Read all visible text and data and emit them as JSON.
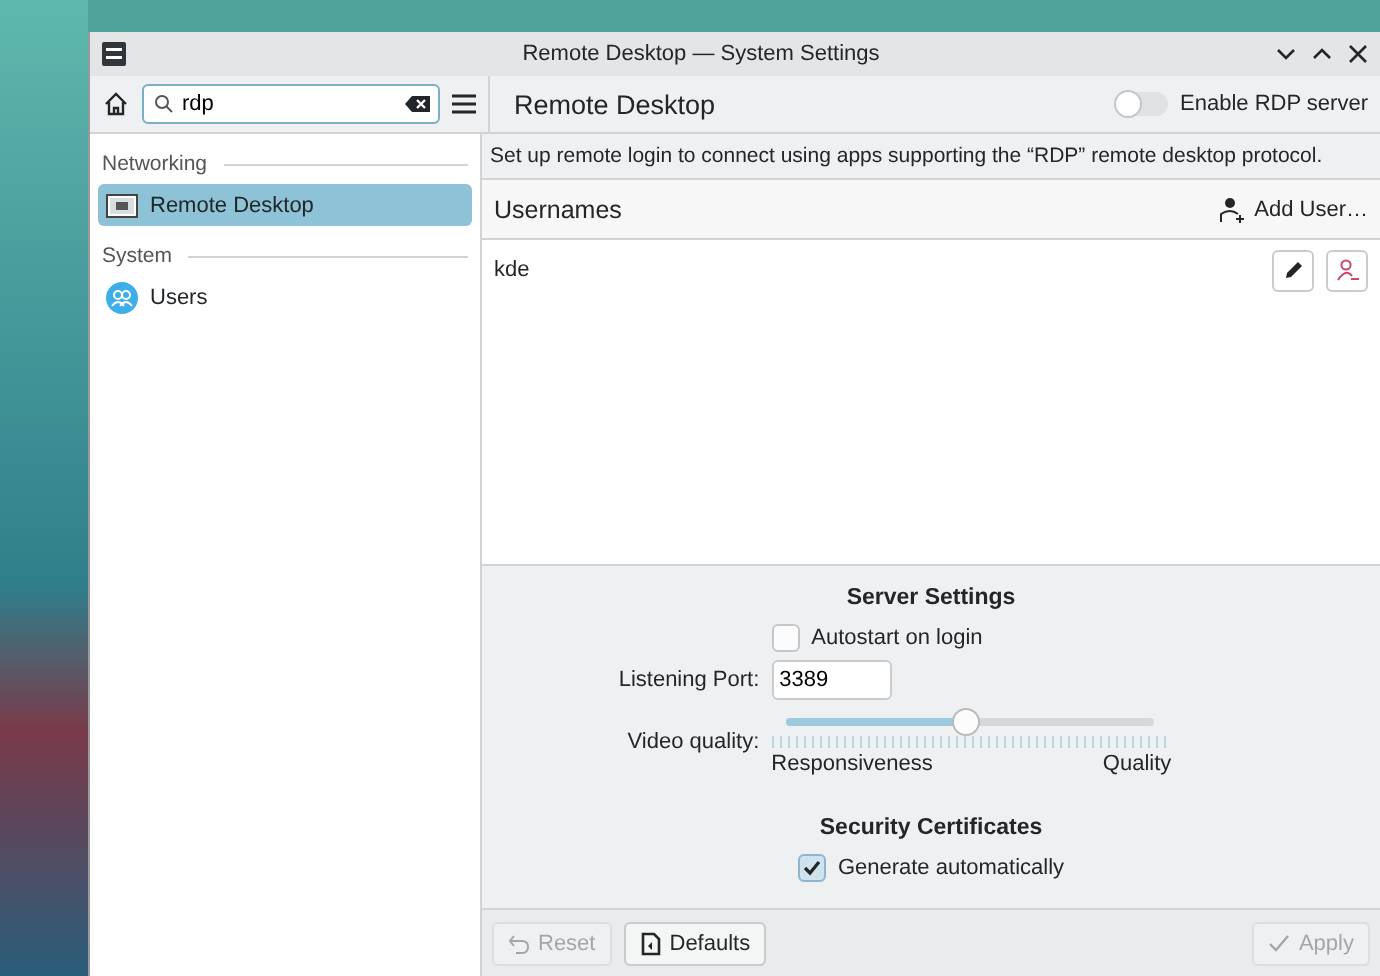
{
  "window": {
    "title": "Remote Desktop — System Settings"
  },
  "toolbar": {
    "search": {
      "value": "rdp"
    }
  },
  "sidebar": {
    "groups": [
      {
        "heading": "Networking",
        "items": [
          {
            "label": "Remote Desktop",
            "selected": true,
            "kind": "monitor"
          }
        ]
      },
      {
        "heading": "System",
        "items": [
          {
            "label": "Users",
            "selected": false,
            "kind": "users"
          }
        ]
      }
    ]
  },
  "page": {
    "title": "Remote Desktop",
    "enable_server": {
      "label": "Enable RDP server",
      "on": false
    },
    "description": "Set up remote login to connect using apps supporting the “RDP” remote desktop protocol.",
    "usernames": {
      "heading": "Usernames",
      "add_button": "Add User…",
      "users": [
        "kde"
      ]
    },
    "server_settings": {
      "heading": "Server Settings",
      "autostart": {
        "label": "Autostart on login",
        "checked": false
      },
      "port": {
        "label": "Listening Port:",
        "value": "3389"
      },
      "video_quality": {
        "label": "Video quality:",
        "level": 0.49,
        "min_label": "Responsiveness",
        "max_label": "Quality"
      }
    },
    "security": {
      "heading": "Security Certificates",
      "generate": {
        "label": "Generate automatically",
        "checked": true
      }
    }
  },
  "footer": {
    "buttons": [
      {
        "label": "Reset",
        "disabled": true,
        "kind": "reset"
      },
      {
        "label": "Defaults",
        "disabled": false,
        "kind": "defaults"
      },
      {
        "label": "Apply",
        "disabled": true,
        "kind": "apply"
      }
    ]
  }
}
